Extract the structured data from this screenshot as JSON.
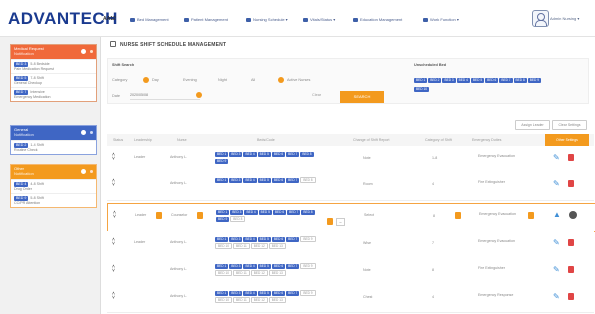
{
  "header": {
    "logo": "ADVANTECH",
    "org": "AA12",
    "nav": [
      {
        "label": "Bed Management"
      },
      {
        "label": "Patient Management"
      },
      {
        "label": "Nursing Schedule ▾"
      },
      {
        "label": "Vitals/Status ▾"
      },
      {
        "label": "Education Management"
      },
      {
        "label": "Work Function ▾"
      }
    ],
    "user": "Admin Nursing ▾"
  },
  "sidebar": {
    "groups": [
      {
        "title": "Medical Request",
        "subtitle": "Notification",
        "color": "#f0693a",
        "cards": [
          {
            "tag": "BED 3",
            "line1": "5-8 Bedside",
            "line2": "Pain Medication Request"
          },
          {
            "tag": "BED 5",
            "line1": "7-8 Shift",
            "line2": "General Checkup"
          },
          {
            "tag": "BED 7",
            "line1": "Intensive",
            "line2": "Emergency Medication"
          }
        ]
      },
      {
        "title": "General",
        "subtitle": "Notification",
        "color": "#3f66c4",
        "cards": [
          {
            "tag": "BED 2",
            "line1": "1-4 Shift",
            "line2": "Routine Check"
          }
        ]
      },
      {
        "title": "Other",
        "subtitle": "Notification",
        "color": "#f39a1e",
        "cards": [
          {
            "tag": "BED 4",
            "line1": "4-8 Shift",
            "line2": "Drug Order"
          },
          {
            "tag": "BED 9",
            "line1": "5-8 Shift",
            "line2": "CC/PR Attention"
          }
        ]
      }
    ]
  },
  "main": {
    "title": "NURSE SHIFT SCHEDULE MANAGEMENT",
    "search": {
      "heading": "Shift Search",
      "category_label": "Category",
      "options": [
        "Day",
        "Evening",
        "Night",
        "All"
      ],
      "active_option": "Day",
      "active_badge": "Active Nurses",
      "date_label": "Date",
      "date_value": "2020/05/08",
      "clear_label": "Clear",
      "search_label": "SEARCH",
      "unscheduled_heading": "Unscheduled Bed",
      "unscheduled_beds": [
        "BED 1",
        "BED 2",
        "BED 3",
        "BED 4",
        "BED 5",
        "BED 6",
        "BED 7",
        "BED 8",
        "BED 9"
      ],
      "unscheduled_beds_row2": [
        "BED 10"
      ]
    },
    "toolbar": {
      "btn1": "Assign Leader",
      "btn2": "Clear Settings"
    },
    "table": {
      "columns": [
        "Status",
        "Leadership",
        "Nurse",
        "Beds/Code",
        "Change of Shift Report",
        "Category of Shift",
        "Emergency Duties",
        "Other Settings"
      ],
      "rows": [
        {
          "leadership": "Leader",
          "nurse": "Anthony L.",
          "beds": [
            "BED 1",
            "BED 3",
            "BED 4",
            "BED 5",
            "BED 6",
            "BED 7",
            "BED 8",
            "BED 9"
          ],
          "extra_beds": [],
          "report": "Note",
          "category": "1-8",
          "duty": "Emergency Evacuation"
        },
        {
          "leadership": "",
          "nurse": "Anthony L.",
          "beds": [
            "BED 1",
            "BED 3",
            "BED 4",
            "BED 5",
            "BED 6",
            "BED 7"
          ],
          "extra_beds": [
            "BED 8"
          ],
          "report": "Room",
          "category": "4",
          "duty": "Fire Extinguisher"
        },
        {
          "leadership": "Leader",
          "nurse": "Counselor",
          "beds": [
            "BED 1",
            "BED 3",
            "BED 4",
            "BED 5",
            "BED 6",
            "BED 7",
            "BED 8",
            "BED 9"
          ],
          "extra_beds": [
            "BED 8"
          ],
          "report": "Select",
          "category": "8",
          "duty": "Emergency Evacuation"
        },
        {
          "leadership": "Leader",
          "nurse": "Anthony L.",
          "beds": [
            "BED 1",
            "BED 3",
            "BED 4",
            "BED 5",
            "BED 6",
            "BED 7"
          ],
          "extra_beds": [
            "BED 9",
            "BED 10",
            "BED 11",
            "BED 12",
            "BED 13"
          ],
          "report": "Wise",
          "category": "7",
          "duty": "Emergency Evacuation"
        },
        {
          "leadership": "",
          "nurse": "Anthony L.",
          "beds": [
            "BED 1",
            "BED 3",
            "BED 4",
            "BED 5",
            "BED 6",
            "BED 7"
          ],
          "extra_beds": [
            "BED 9",
            "BED 10",
            "BED 11",
            "BED 12",
            "BED 13"
          ],
          "report": "Note",
          "category": "8",
          "duty": "Fire Extinguisher"
        },
        {
          "leadership": "",
          "nurse": "Anthony L.",
          "beds": [
            "BED 1",
            "BED 3",
            "BED 4",
            "BED 5",
            "BED 6",
            "BED 7"
          ],
          "extra_beds": [
            "BED 9",
            "BED 10",
            "BED 11",
            "BED 12",
            "BED 13"
          ],
          "report": "Chest",
          "category": "4",
          "duty": "Emergency Response"
        }
      ]
    }
  },
  "colors": {
    "accent": "#f39a1e",
    "primary": "#3f66c4",
    "danger": "#e04545",
    "brand": "#1a3a8f"
  }
}
